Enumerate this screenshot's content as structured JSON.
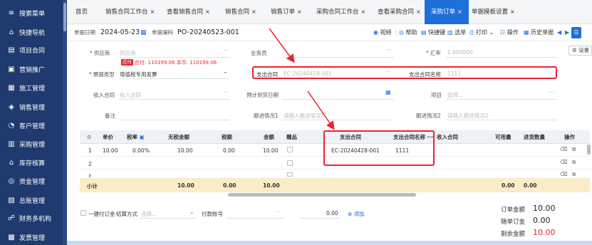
{
  "sidebar": {
    "items": [
      {
        "icon": "search-menu-icon",
        "glyph": "≡",
        "label": "搜索菜单"
      },
      {
        "icon": "home-icon",
        "glyph": "⌂",
        "label": "快捷导航"
      },
      {
        "icon": "project-icon",
        "glyph": "▤",
        "label": "项目合同"
      },
      {
        "icon": "gift-icon",
        "glyph": "▣",
        "label": "营销推广"
      },
      {
        "icon": "construction-icon",
        "glyph": "▦",
        "label": "施工管理"
      },
      {
        "icon": "sales-icon",
        "glyph": "◈",
        "label": "销售管理"
      },
      {
        "icon": "customer-icon",
        "glyph": "◔",
        "label": "客户管理"
      },
      {
        "icon": "purchase-icon",
        "glyph": "▥",
        "label": "采购管理"
      },
      {
        "icon": "inventory-icon",
        "glyph": "⌂",
        "label": "库存核算"
      },
      {
        "icon": "fund-icon",
        "glyph": "◎",
        "label": "资金管理"
      },
      {
        "icon": "ledger-icon",
        "glyph": "▧",
        "label": "总账管理"
      },
      {
        "icon": "finance-icon",
        "glyph": "☍",
        "label": "财务多机构"
      },
      {
        "icon": "invoice-icon",
        "glyph": "▩",
        "label": "发票管理"
      }
    ]
  },
  "tabs": [
    {
      "label": "首页",
      "closable": false
    },
    {
      "label": "销售合同工作台",
      "closable": true
    },
    {
      "label": "查看销售合同",
      "closable": true
    },
    {
      "label": "销售合同",
      "closable": true
    },
    {
      "label": "销售订单",
      "closable": true
    },
    {
      "label": "采购合同工作台",
      "closable": true
    },
    {
      "label": "查看采购合同",
      "closable": true
    },
    {
      "label": "采购订单",
      "closable": true,
      "active": true
    },
    {
      "label": "单据模板设置",
      "closable": true
    }
  ],
  "tab_close_glyph": "×",
  "info": {
    "date_label": "单据日期",
    "date_value": "2024-05-23",
    "code_label": "单据编码",
    "code_value": "PO-20240523-001",
    "toolbar": [
      "视频",
      "帮助",
      "快捷键",
      "选单",
      "打印",
      "操作",
      "历史单据"
    ],
    "settings": "设置"
  },
  "form": {
    "supplier_label": "供应商",
    "supplier_placeholder": "供应商",
    "payable_tag": "应付",
    "payable_text": "应付: 110199.06 本币: 110199.06",
    "salesman_label": "业务员",
    "rate_label": "汇率",
    "rate_value": "1.000000",
    "doctype_label": "票据类型",
    "doctype_value": "增值税专用发票",
    "expense_contract_label": "支出合同",
    "expense_contract_value": "EC-20240428-001",
    "expense_contract_name_label": "支出合同名称",
    "expense_contract_name_value": "1111",
    "income_contract_label": "收入合同",
    "income_contract_placeholder": "收入合同",
    "expected_date_label": "预计到货日期",
    "project_label": "项目",
    "project_placeholder": "选择...",
    "remark_label": "备注",
    "progress1_label": "跟进情况1",
    "progress1_placeholder": "请输入跟进情况1",
    "progress2_label": "跟进情况2",
    "progress2_placeholder": "请输入跟进情况2"
  },
  "table": {
    "headers": [
      "单价",
      "税率",
      "无税金额",
      "税额",
      "金额",
      "赠品",
      "支出合同",
      "支出合同名称",
      "收入合同",
      "可用量",
      "进货数量",
      "操作"
    ],
    "rows": [
      {
        "no": "1",
        "price": "10.00",
        "tax_rate": "0.00%",
        "net": "10.00",
        "tax": "0.00",
        "amount": "10.00",
        "contract": "EC-20240428-001",
        "contract_name": "1111"
      },
      {
        "no": "2"
      },
      {
        "no": "3"
      }
    ],
    "total_label": "小计",
    "total_net": "10.00",
    "total_tax": "0.00",
    "total_amount": "10.00",
    "total_avail": "0.00",
    "total_qty": "0.00"
  },
  "bottom": {
    "deposit_label": "一键付订金",
    "settle_label": "结算方式",
    "settle_placeholder": "选择...",
    "pay_account_label": "付款账号",
    "pay_value": "0.00",
    "add_label": "添加",
    "order_amount_label": "订单金额",
    "order_amount": "10.00",
    "deposit_amount_label": "随单订金",
    "deposit_amount": "0.00",
    "remaining_label": "剩余金额",
    "remaining": "10.00"
  }
}
